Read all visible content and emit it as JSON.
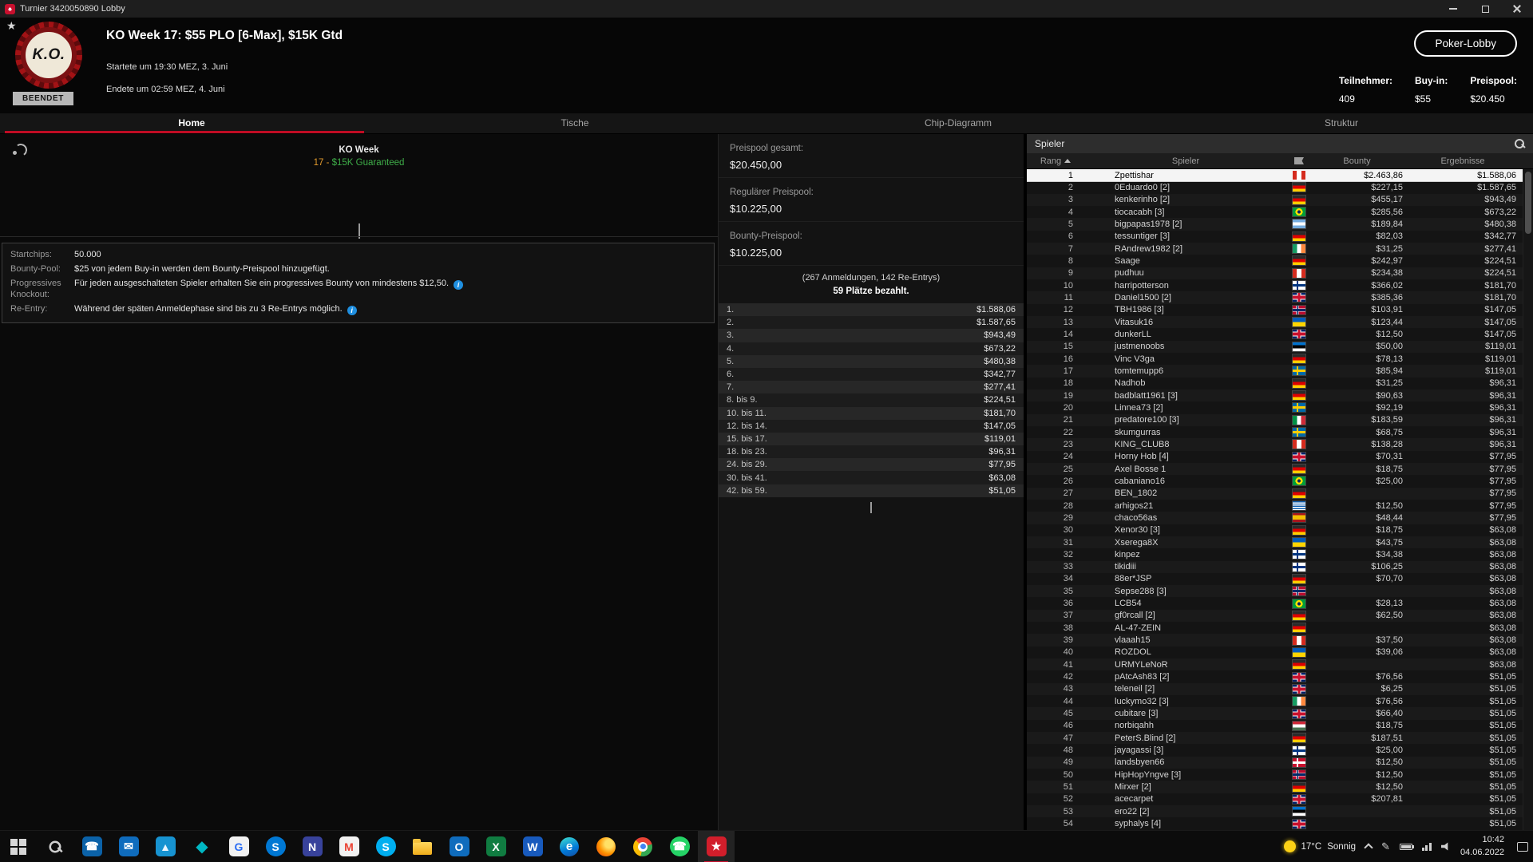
{
  "window": {
    "title": "Turnier 3420050890 Lobby",
    "icons": [
      "app-icon",
      "minimize",
      "maximize",
      "close"
    ]
  },
  "header": {
    "favorite_icon": "star-icon",
    "logo_text": "K.O.",
    "badge": "BEENDET",
    "title": "KO Week 17: $55 PLO [6-Max], $15K Gtd",
    "started": "Startete um 19:30 MEZ, 3. Juni",
    "ended": "Endete um 02:59 MEZ, 4. Juni",
    "lobby_button": "Poker-Lobby",
    "stats": [
      {
        "label": "Teilnehmer:",
        "value": "409"
      },
      {
        "label": "Buy-in:",
        "value": "$55"
      },
      {
        "label": "Preispool:",
        "value": "$20.450"
      }
    ]
  },
  "tabs": [
    {
      "label": "Home",
      "active": true
    },
    {
      "label": "Tische",
      "active": false
    },
    {
      "label": "Chip-Diagramm",
      "active": false
    },
    {
      "label": "Struktur",
      "active": false
    }
  ],
  "colors": {
    "accent_red": "#c00c24",
    "guarantee_green": "#3fae49",
    "guarantee_orange": "#e39b2d",
    "info_blue": "#1f8fe0"
  },
  "left_panel": {
    "broadcast_icon": "broadcast-icon",
    "banner_title": "KO Week",
    "banner_sub_prefix": "17 - ",
    "banner_sub_main": "$15K Guaranteed",
    "info_rows": [
      {
        "label": "Startchips:",
        "text": "50.000",
        "info": false
      },
      {
        "label": "Bounty-Pool:",
        "text": "$25 von jedem Buy-in werden dem Bounty-Preispool hinzugefügt.",
        "info": false
      },
      {
        "label": "Progressives Knockout:",
        "text": "Für jeden ausgeschalteten Spieler erhalten Sie ein progressives Bounty von mindestens $12,50.",
        "info": true
      },
      {
        "label": "Re-Entry:",
        "text": "Während der späten Anmeldephase sind bis zu 3 Re-Entrys möglich.",
        "info": true
      }
    ]
  },
  "prize_panel": {
    "total_label": "Preispool gesamt:",
    "total_value": "$20.450,00",
    "regular_label": "Regulärer Preispool:",
    "regular_value": "$10.225,00",
    "bounty_label": "Bounty-Preispool:",
    "bounty_value": "$10.225,00",
    "entries_line": "(267 Anmeldungen, 142 Re-Entrys)",
    "paid_line": "59 Plätze bezahlt.",
    "payouts": [
      {
        "place": "1.",
        "amount": "$1.588,06"
      },
      {
        "place": "2.",
        "amount": "$1.587,65"
      },
      {
        "place": "3.",
        "amount": "$943,49"
      },
      {
        "place": "4.",
        "amount": "$673,22"
      },
      {
        "place": "5.",
        "amount": "$480,38"
      },
      {
        "place": "6.",
        "amount": "$342,77"
      },
      {
        "place": "7.",
        "amount": "$277,41"
      },
      {
        "place": "8. bis 9.",
        "amount": "$224,51"
      },
      {
        "place": "10. bis 11.",
        "amount": "$181,70"
      },
      {
        "place": "12. bis 14.",
        "amount": "$147,05"
      },
      {
        "place": "15. bis 17.",
        "amount": "$119,01"
      },
      {
        "place": "18. bis 23.",
        "amount": "$96,31"
      },
      {
        "place": "24. bis 29.",
        "amount": "$77,95"
      },
      {
        "place": "30. bis 41.",
        "amount": "$63,08"
      },
      {
        "place": "42. bis 59.",
        "amount": "$51,05"
      }
    ]
  },
  "players_panel": {
    "title": "Spieler",
    "search_icon": "search-icon",
    "columns": {
      "rank": "Rang",
      "player": "Spieler",
      "bounty": "Bounty",
      "results": "Ergebnisse"
    },
    "rows": [
      {
        "rank": "1",
        "name": "Zpettishar",
        "flag": "ca",
        "bounty": "$2.463,86",
        "result": "$1.588,06",
        "selected": true
      },
      {
        "rank": "2",
        "name": "0Eduardo0 [2]",
        "flag": "de",
        "bounty": "$227,15",
        "result": "$1.587,65"
      },
      {
        "rank": "3",
        "name": "kenkerinho [2]",
        "flag": "de",
        "bounty": "$455,17",
        "result": "$943,49"
      },
      {
        "rank": "4",
        "name": "tiocacabh [3]",
        "flag": "br",
        "bounty": "$285,56",
        "result": "$673,22"
      },
      {
        "rank": "5",
        "name": "bigpapas1978 [2]",
        "flag": "ar",
        "bounty": "$189,84",
        "result": "$480,38"
      },
      {
        "rank": "6",
        "name": "tessuntiger [3]",
        "flag": "de",
        "bounty": "$82,03",
        "result": "$342,77"
      },
      {
        "rank": "7",
        "name": "RAndrew1982 [2]",
        "flag": "ie",
        "bounty": "$31,25",
        "result": "$277,41"
      },
      {
        "rank": "8",
        "name": "Saage",
        "flag": "de",
        "bounty": "$242,97",
        "result": "$224,51"
      },
      {
        "rank": "9",
        "name": "pudhuu",
        "flag": "ca",
        "bounty": "$234,38",
        "result": "$224,51"
      },
      {
        "rank": "10",
        "name": "harripotterson",
        "flag": "fi",
        "bounty": "$366,02",
        "result": "$181,70"
      },
      {
        "rank": "11",
        "name": "Daniel1500 [2]",
        "flag": "gb",
        "bounty": "$385,36",
        "result": "$181,70"
      },
      {
        "rank": "12",
        "name": "TBH1986 [3]",
        "flag": "no",
        "bounty": "$103,91",
        "result": "$147,05"
      },
      {
        "rank": "13",
        "name": "Vitasuk16",
        "flag": "ua",
        "bounty": "$123,44",
        "result": "$147,05"
      },
      {
        "rank": "14",
        "name": "dunkerLL",
        "flag": "gb",
        "bounty": "$12,50",
        "result": "$147,05"
      },
      {
        "rank": "15",
        "name": "justmenoobs",
        "flag": "ee",
        "bounty": "$50,00",
        "result": "$119,01"
      },
      {
        "rank": "16",
        "name": "Vinc V3ga",
        "flag": "de",
        "bounty": "$78,13",
        "result": "$119,01"
      },
      {
        "rank": "17",
        "name": "tomtemupp6",
        "flag": "se",
        "bounty": "$85,94",
        "result": "$119,01"
      },
      {
        "rank": "18",
        "name": "Nadhob",
        "flag": "de",
        "bounty": "$31,25",
        "result": "$96,31"
      },
      {
        "rank": "19",
        "name": "badblatt1961 [3]",
        "flag": "de",
        "bounty": "$90,63",
        "result": "$96,31"
      },
      {
        "rank": "20",
        "name": "Linnea73 [2]",
        "flag": "se",
        "bounty": "$92,19",
        "result": "$96,31"
      },
      {
        "rank": "21",
        "name": "predatore100 [3]",
        "flag": "it",
        "bounty": "$183,59",
        "result": "$96,31"
      },
      {
        "rank": "22",
        "name": "skumgurras",
        "flag": "se",
        "bounty": "$68,75",
        "result": "$96,31"
      },
      {
        "rank": "23",
        "name": "KING_CLUB8",
        "flag": "ca",
        "bounty": "$138,28",
        "result": "$96,31"
      },
      {
        "rank": "24",
        "name": "Horny Hob [4]",
        "flag": "gb",
        "bounty": "$70,31",
        "result": "$77,95"
      },
      {
        "rank": "25",
        "name": "Axel Bosse 1",
        "flag": "de",
        "bounty": "$18,75",
        "result": "$77,95"
      },
      {
        "rank": "26",
        "name": "cabaniano16",
        "flag": "br",
        "bounty": "$25,00",
        "result": "$77,95"
      },
      {
        "rank": "27",
        "name": "BEN_1802",
        "flag": "de",
        "bounty": "",
        "result": "$77,95"
      },
      {
        "rank": "28",
        "name": "arhigos21",
        "flag": "gr",
        "bounty": "$12,50",
        "result": "$77,95"
      },
      {
        "rank": "29",
        "name": "chaco56as",
        "flag": "es",
        "bounty": "$48,44",
        "result": "$77,95"
      },
      {
        "rank": "30",
        "name": "Xenor30 [3]",
        "flag": "de",
        "bounty": "$18,75",
        "result": "$63,08"
      },
      {
        "rank": "31",
        "name": "Xserega8X",
        "flag": "ua",
        "bounty": "$43,75",
        "result": "$63,08"
      },
      {
        "rank": "32",
        "name": "kinpez",
        "flag": "fi",
        "bounty": "$34,38",
        "result": "$63,08"
      },
      {
        "rank": "33",
        "name": "tikidiii",
        "flag": "fi",
        "bounty": "$106,25",
        "result": "$63,08"
      },
      {
        "rank": "34",
        "name": "88er*JSP",
        "flag": "de",
        "bounty": "$70,70",
        "result": "$63,08"
      },
      {
        "rank": "35",
        "name": "Sepse288 [3]",
        "flag": "no",
        "bounty": "",
        "result": "$63,08"
      },
      {
        "rank": "36",
        "name": "LCB54",
        "flag": "br",
        "bounty": "$28,13",
        "result": "$63,08"
      },
      {
        "rank": "37",
        "name": "gf0rcall [2]",
        "flag": "de",
        "bounty": "$62,50",
        "result": "$63,08"
      },
      {
        "rank": "38",
        "name": "AL-47-ZEIN",
        "flag": "de",
        "bounty": "",
        "result": "$63,08"
      },
      {
        "rank": "39",
        "name": "vlaaah15",
        "flag": "ca",
        "bounty": "$37,50",
        "result": "$63,08"
      },
      {
        "rank": "40",
        "name": "ROZDOL",
        "flag": "ua",
        "bounty": "$39,06",
        "result": "$63,08"
      },
      {
        "rank": "41",
        "name": "URMYLeNoR",
        "flag": "de",
        "bounty": "",
        "result": "$63,08"
      },
      {
        "rank": "42",
        "name": "pAtcAsh83 [2]",
        "flag": "gb",
        "bounty": "$76,56",
        "result": "$51,05"
      },
      {
        "rank": "43",
        "name": "teleneil [2]",
        "flag": "gb",
        "bounty": "$6,25",
        "result": "$51,05"
      },
      {
        "rank": "44",
        "name": "luckymo32 [3]",
        "flag": "ie",
        "bounty": "$76,56",
        "result": "$51,05"
      },
      {
        "rank": "45",
        "name": "cubitare [3]",
        "flag": "gb",
        "bounty": "$66,40",
        "result": "$51,05"
      },
      {
        "rank": "46",
        "name": "norbiqahh",
        "flag": "hu",
        "bounty": "$18,75",
        "result": "$51,05"
      },
      {
        "rank": "47",
        "name": "PeterS.Blind [2]",
        "flag": "de",
        "bounty": "$187,51",
        "result": "$51,05"
      },
      {
        "rank": "48",
        "name": "jayagassi [3]",
        "flag": "fi",
        "bounty": "$25,00",
        "result": "$51,05"
      },
      {
        "rank": "49",
        "name": "landsbyen66",
        "flag": "dk",
        "bounty": "$12,50",
        "result": "$51,05"
      },
      {
        "rank": "50",
        "name": "HipHopYngve [3]",
        "flag": "no",
        "bounty": "$12,50",
        "result": "$51,05"
      },
      {
        "rank": "51",
        "name": "Mirxer [2]",
        "flag": "de",
        "bounty": "$12,50",
        "result": "$51,05"
      },
      {
        "rank": "52",
        "name": "acecarpet",
        "flag": "gb",
        "bounty": "$207,81",
        "result": "$51,05"
      },
      {
        "rank": "53",
        "name": "ero22 [2]",
        "flag": "ee",
        "bounty": "",
        "result": "$51,05"
      },
      {
        "rank": "54",
        "name": "syphalys [4]",
        "flag": "gb",
        "bounty": "",
        "result": "$51,05"
      }
    ]
  },
  "taskbar": {
    "buttons": [
      {
        "name": "start",
        "type": "windows"
      },
      {
        "name": "search",
        "type": "search"
      },
      {
        "name": "phone-link",
        "type": "square",
        "bg": "#0b62a8",
        "glyph": "☎",
        "fg": "#ffffff"
      },
      {
        "name": "mail",
        "type": "square",
        "bg": "#0f6cbd",
        "glyph": "✉",
        "fg": "#ffffff"
      },
      {
        "name": "photos",
        "type": "square",
        "bg": "#1793d1",
        "glyph": "▲",
        "fg": "#eaf6ff"
      },
      {
        "name": "store",
        "type": "plain",
        "glyph": "◆",
        "fg": "#00b7c3"
      },
      {
        "name": "ga-browser",
        "type": "square",
        "bg": "#f2f2f2",
        "glyph": "G",
        "fg": "#2a6df4"
      },
      {
        "name": "skype-preview",
        "type": "circle",
        "bg": "#0078d4",
        "glyph": "S",
        "fg": "#ffffff"
      },
      {
        "name": "onenote",
        "type": "square",
        "bg": "#38429b",
        "glyph": "N",
        "fg": "#ffffff"
      },
      {
        "name": "gmail",
        "type": "square",
        "bg": "#f2f2f2",
        "glyph": "M",
        "fg": "#ea4335"
      },
      {
        "name": "skype",
        "type": "circle",
        "bg": "#00aff0",
        "glyph": "S",
        "fg": "#ffffff"
      },
      {
        "name": "file-explorer",
        "type": "folder"
      },
      {
        "name": "outlook",
        "type": "square",
        "bg": "#0f6cbd",
        "glyph": "O",
        "fg": "#ffffff"
      },
      {
        "name": "excel",
        "type": "square",
        "bg": "#107c41",
        "glyph": "X",
        "fg": "#ffffff"
      },
      {
        "name": "word",
        "type": "square",
        "bg": "#185abd",
        "glyph": "W",
        "fg": "#ffffff"
      },
      {
        "name": "edge",
        "type": "edge",
        "glyph": "e"
      },
      {
        "name": "firefox",
        "type": "firefox"
      },
      {
        "name": "chrome",
        "type": "chrome"
      },
      {
        "name": "whatsapp",
        "type": "circle",
        "bg": "#25d366",
        "glyph": "☎",
        "fg": "#ffffff"
      },
      {
        "name": "pokerstars",
        "type": "square",
        "bg": "#d21e2b",
        "glyph": "★",
        "fg": "#ffffff",
        "active": true
      }
    ],
    "tray": {
      "weather_temp": "17°C",
      "weather_desc": "Sonnig",
      "time": "10:42",
      "date": "04.06.2022"
    }
  }
}
